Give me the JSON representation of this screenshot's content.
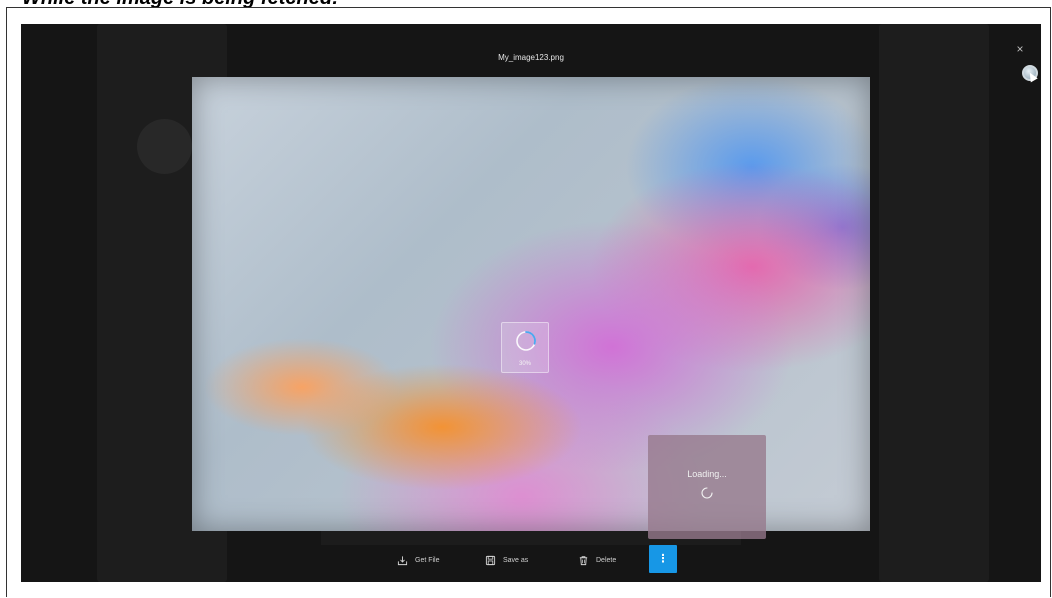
{
  "page": {
    "heading": "While the image is being fetched:"
  },
  "viewer": {
    "file_name": "My_image123.png",
    "close_icon": "×",
    "progress": {
      "percent_label": "30%",
      "value": 0.3
    },
    "loading": {
      "label": "Loading..."
    },
    "toolbar": {
      "get_file_label": "Get File",
      "save_as_label": "Save as",
      "delete_label": "Delete",
      "more_icon": "⋮"
    },
    "icons": {
      "close": "close-icon",
      "get_file": "download-icon",
      "save_as": "floppy-disk-icon",
      "delete": "trash-icon",
      "more": "more-vertical-icon"
    },
    "colors": {
      "background": "#151515",
      "accent": "#1797e6",
      "spinner": "#4aa8f0"
    }
  }
}
